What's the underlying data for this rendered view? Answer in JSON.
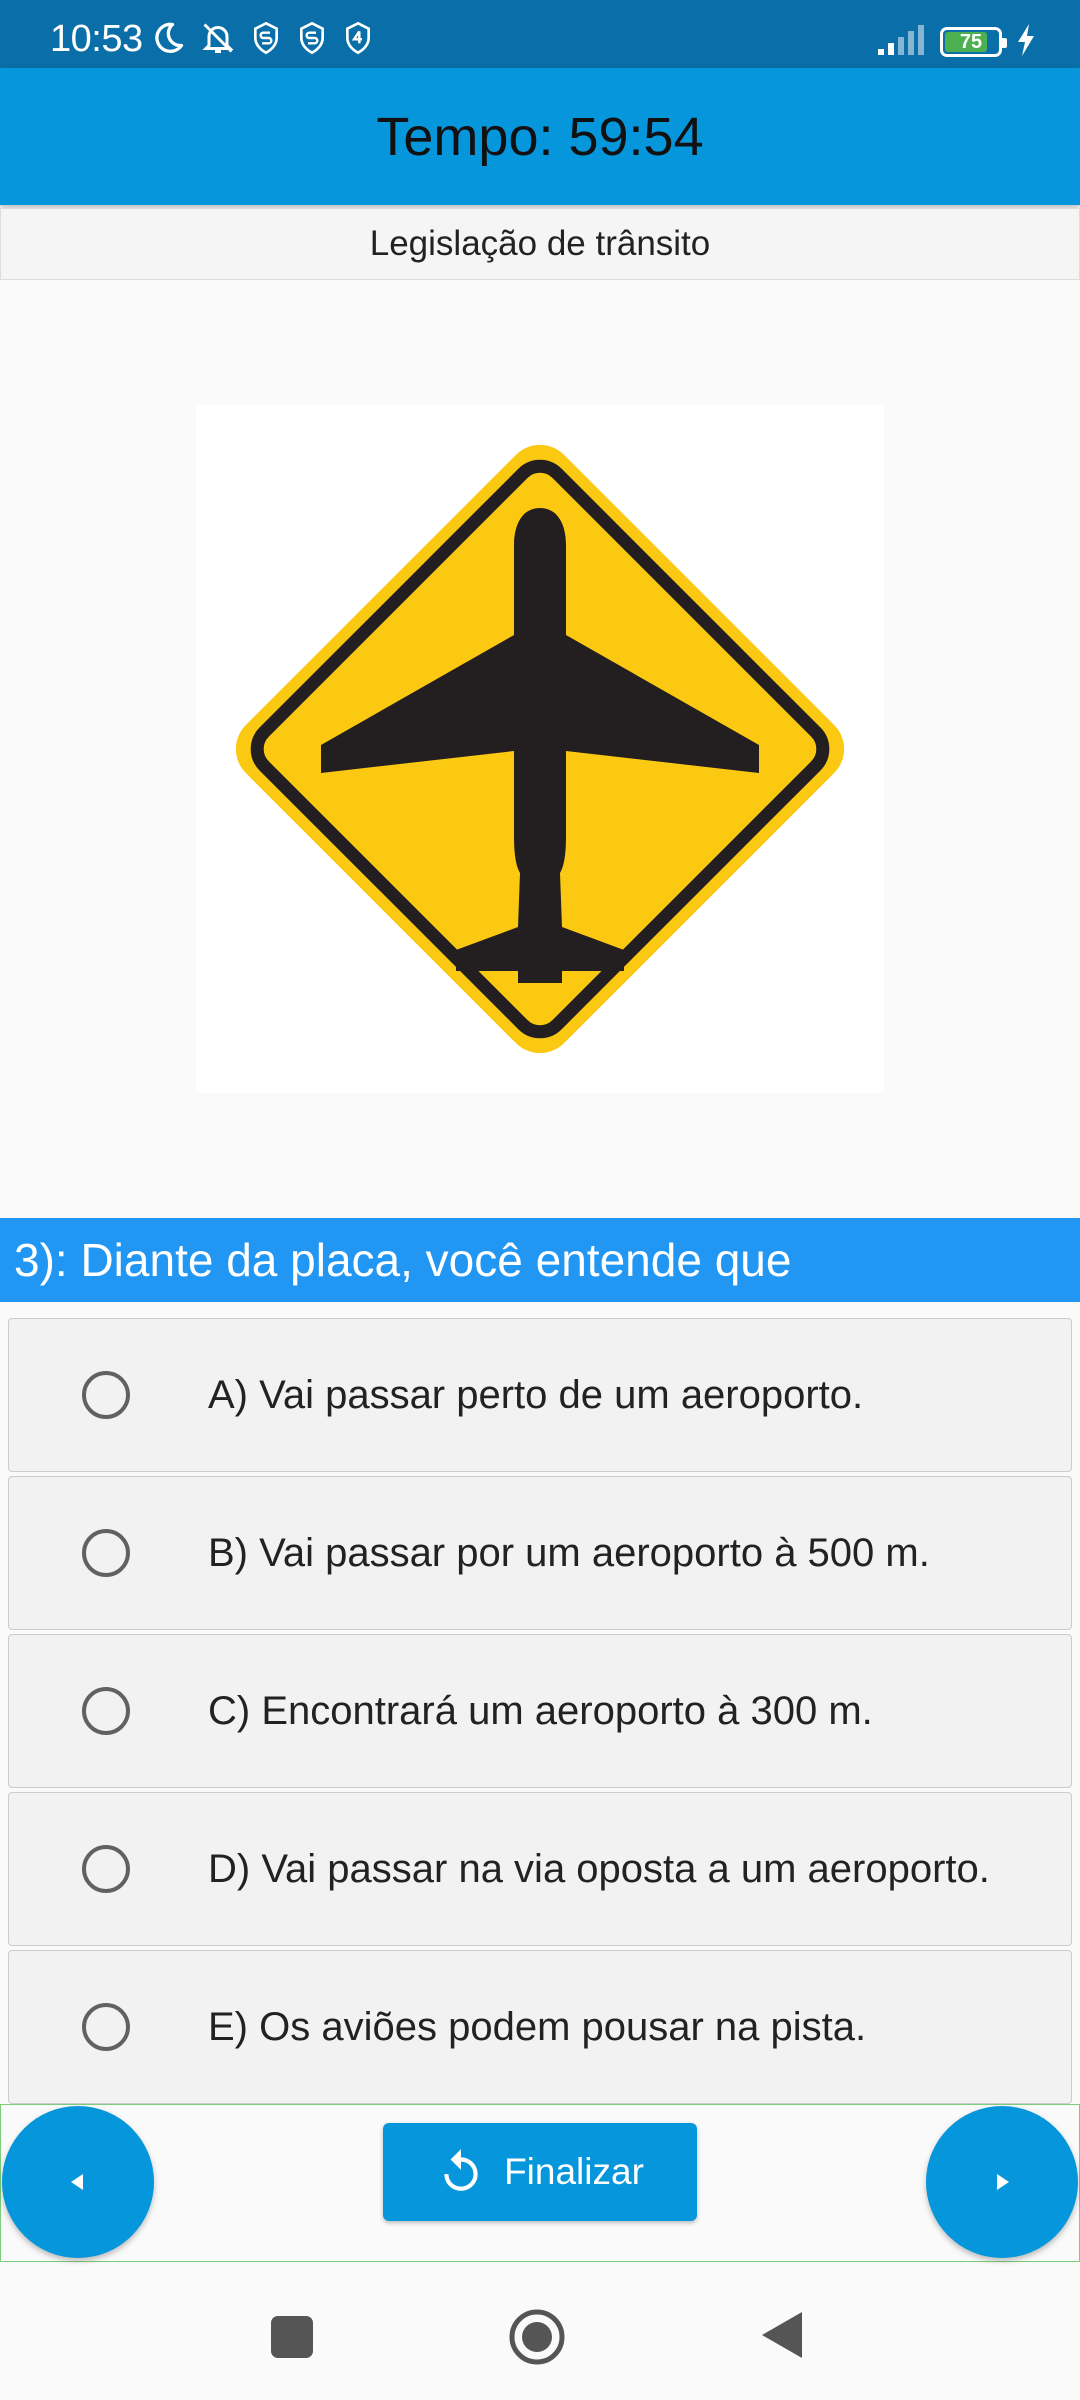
{
  "status_bar": {
    "time": "10:53",
    "battery_level": "75",
    "icons_left": [
      "moon-icon",
      "bell-off-icon",
      "shield-s-icon",
      "shield-s-icon",
      "shield-4-icon"
    ],
    "icons_right": [
      "signal-icon",
      "battery-icon",
      "charging-bolt-icon"
    ]
  },
  "app_bar": {
    "title": "Tempo: 59:54"
  },
  "category": {
    "label": "Legislação de trânsito"
  },
  "sign": {
    "icon": "airport-warning-sign",
    "colors": {
      "fill": "#fbc812",
      "border": "#231f20",
      "symbol": "#231f20"
    }
  },
  "question": {
    "text": "3): Diante da placa, você entende que"
  },
  "options": [
    {
      "label": "A) Vai passar perto de um aeroporto."
    },
    {
      "label": "B) Vai passar por um aeroporto à 500 m."
    },
    {
      "label": "C) Encontrará um aeroporto à 300 m."
    },
    {
      "label": "D) Vai passar na via oposta a um aeroporto."
    },
    {
      "label": "E) Os aviões podem pousar na pista."
    }
  ],
  "bottom_actions": {
    "prev_icon": "arrow-left-icon",
    "next_icon": "arrow-right-icon",
    "finalize_label": "Finalizar",
    "finalize_icon": "refresh-icon"
  },
  "nav_bar": {
    "icons": [
      "recents-icon",
      "home-icon",
      "back-icon"
    ]
  },
  "colors": {
    "status_bar": "#0a6fa8",
    "app_bar": "#0596dc",
    "question_bar": "#2196f3",
    "option_bg": "#f3f2f2",
    "panel_border": "#7ccd7c"
  }
}
